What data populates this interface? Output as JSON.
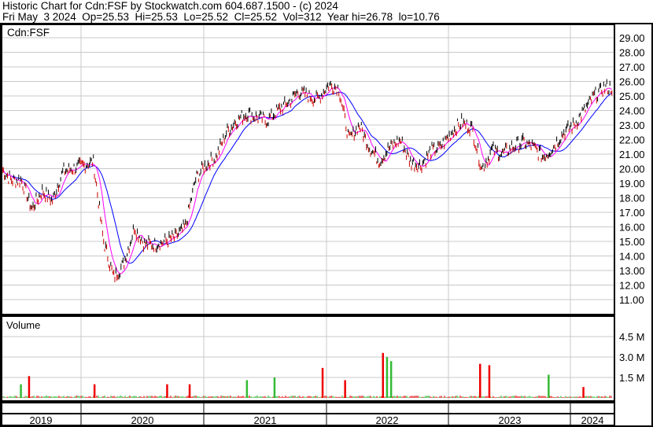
{
  "header": {
    "title": "Historic Chart for Cdn:FSF by Stockwatch.com 604.687.1500 - (c) 2024",
    "quote": "Fri May  3 2024  Op=25.53  Hi=25.53  Lo=25.52  Cl=25.52  Vol=312  Year hi=26.78  lo=10.76"
  },
  "chart_data": {
    "type": "line",
    "symbol": "Cdn:FSF",
    "volume_label": "Volume",
    "ylim": [
      10,
      30
    ],
    "y_ticks": [
      "11.00",
      "12.00",
      "13.00",
      "14.00",
      "15.00",
      "16.00",
      "17.00",
      "18.00",
      "19.00",
      "20.00",
      "21.00",
      "22.00",
      "23.00",
      "24.00",
      "25.00",
      "26.00",
      "27.00",
      "28.00",
      "29.00"
    ],
    "volume_ticks": [
      {
        "label": "1.5 M",
        "value": 1.5
      },
      {
        "label": "3.0 M",
        "value": 3.0
      },
      {
        "label": "4.5 M",
        "value": 4.5
      }
    ],
    "x_labels": [
      "2019",
      "2020",
      "2021",
      "2022",
      "2023",
      "2024"
    ],
    "start_month_offset": -7.8,
    "months": [
      "2019-05",
      "2019-06",
      "2019-07",
      "2019-08",
      "2019-09",
      "2019-10",
      "2019-11",
      "2019-12",
      "2020-01",
      "2020-02",
      "2020-03",
      "2020-04",
      "2020-05",
      "2020-06",
      "2020-07",
      "2020-08",
      "2020-09",
      "2020-10",
      "2020-11",
      "2020-12",
      "2021-01",
      "2021-02",
      "2021-03",
      "2021-04",
      "2021-05",
      "2021-06",
      "2021-07",
      "2021-08",
      "2021-09",
      "2021-10",
      "2021-11",
      "2021-12",
      "2022-01",
      "2022-02",
      "2022-03",
      "2022-04",
      "2022-05",
      "2022-06",
      "2022-07",
      "2022-08",
      "2022-09",
      "2022-10",
      "2022-11",
      "2022-12",
      "2023-01",
      "2023-02",
      "2023-03",
      "2023-04",
      "2023-05",
      "2023-06",
      "2023-07",
      "2023-08",
      "2023-09",
      "2023-10",
      "2023-11",
      "2023-12",
      "2024-01",
      "2024-02",
      "2024-03",
      "2024-04",
      "2024-05"
    ],
    "close": [
      20.0,
      19.2,
      19.2,
      17.2,
      18.5,
      17.8,
      19.8,
      20.0,
      20.2,
      20.5,
      15.0,
      12.5,
      13.5,
      16.0,
      14.8,
      14.8,
      15.0,
      15.3,
      16.0,
      19.3,
      20.3,
      20.8,
      22.5,
      23.3,
      23.8,
      23.5,
      23.3,
      24.0,
      24.5,
      25.3,
      25.0,
      24.8,
      25.8,
      25.5,
      22.0,
      23.0,
      21.5,
      20.5,
      21.5,
      22.0,
      20.5,
      20.2,
      21.2,
      21.5,
      22.5,
      23.2,
      22.8,
      20.0,
      21.3,
      21.0,
      21.5,
      21.8,
      21.5,
      20.8,
      21.5,
      22.5,
      23.0,
      24.0,
      25.0,
      25.6,
      25.52
    ],
    "series": [
      {
        "name": "Price",
        "color": "#cc0000"
      },
      {
        "name": "Short MA",
        "color": "#ff00ff"
      },
      {
        "name": "Long MA",
        "color": "#0000ff"
      }
    ],
    "volume_spikes": [
      [
        -5.9,
        1.0,
        "up"
      ],
      [
        -5.1,
        1.6,
        "down"
      ],
      [
        1.3,
        1.0,
        "down"
      ],
      [
        8.4,
        1.0,
        "down"
      ],
      [
        10.6,
        1.0,
        "down"
      ],
      [
        16.2,
        1.3,
        "up"
      ],
      [
        18.9,
        1.5,
        "up"
      ],
      [
        23.6,
        2.2,
        "down"
      ],
      [
        25.8,
        1.3,
        "down"
      ],
      [
        29.5,
        3.3,
        "down"
      ],
      [
        29.9,
        3.0,
        "up"
      ],
      [
        30.3,
        2.7,
        "up"
      ],
      [
        39.0,
        2.5,
        "down"
      ],
      [
        39.9,
        2.4,
        "down"
      ],
      [
        45.7,
        1.7,
        "up"
      ],
      [
        49.1,
        0.8,
        "down"
      ]
    ]
  }
}
